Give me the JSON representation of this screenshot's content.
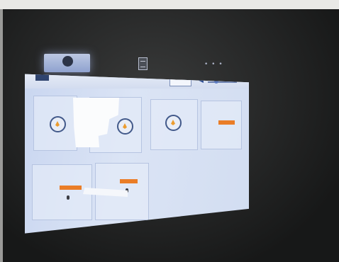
{
  "photo_text": "",
  "screen": {
    "badge": "",
    "title": "",
    "subtitle": "",
    "customer_label": "",
    "customer_select_value": "",
    "tiles": []
  },
  "colors": {
    "screen_bg": "#d2ddf1",
    "tile_border": "#b6c4e1",
    "accent_blue": "#3a5ba2",
    "flame": "#ec9c2f",
    "level_bar": "#ea7d27"
  }
}
